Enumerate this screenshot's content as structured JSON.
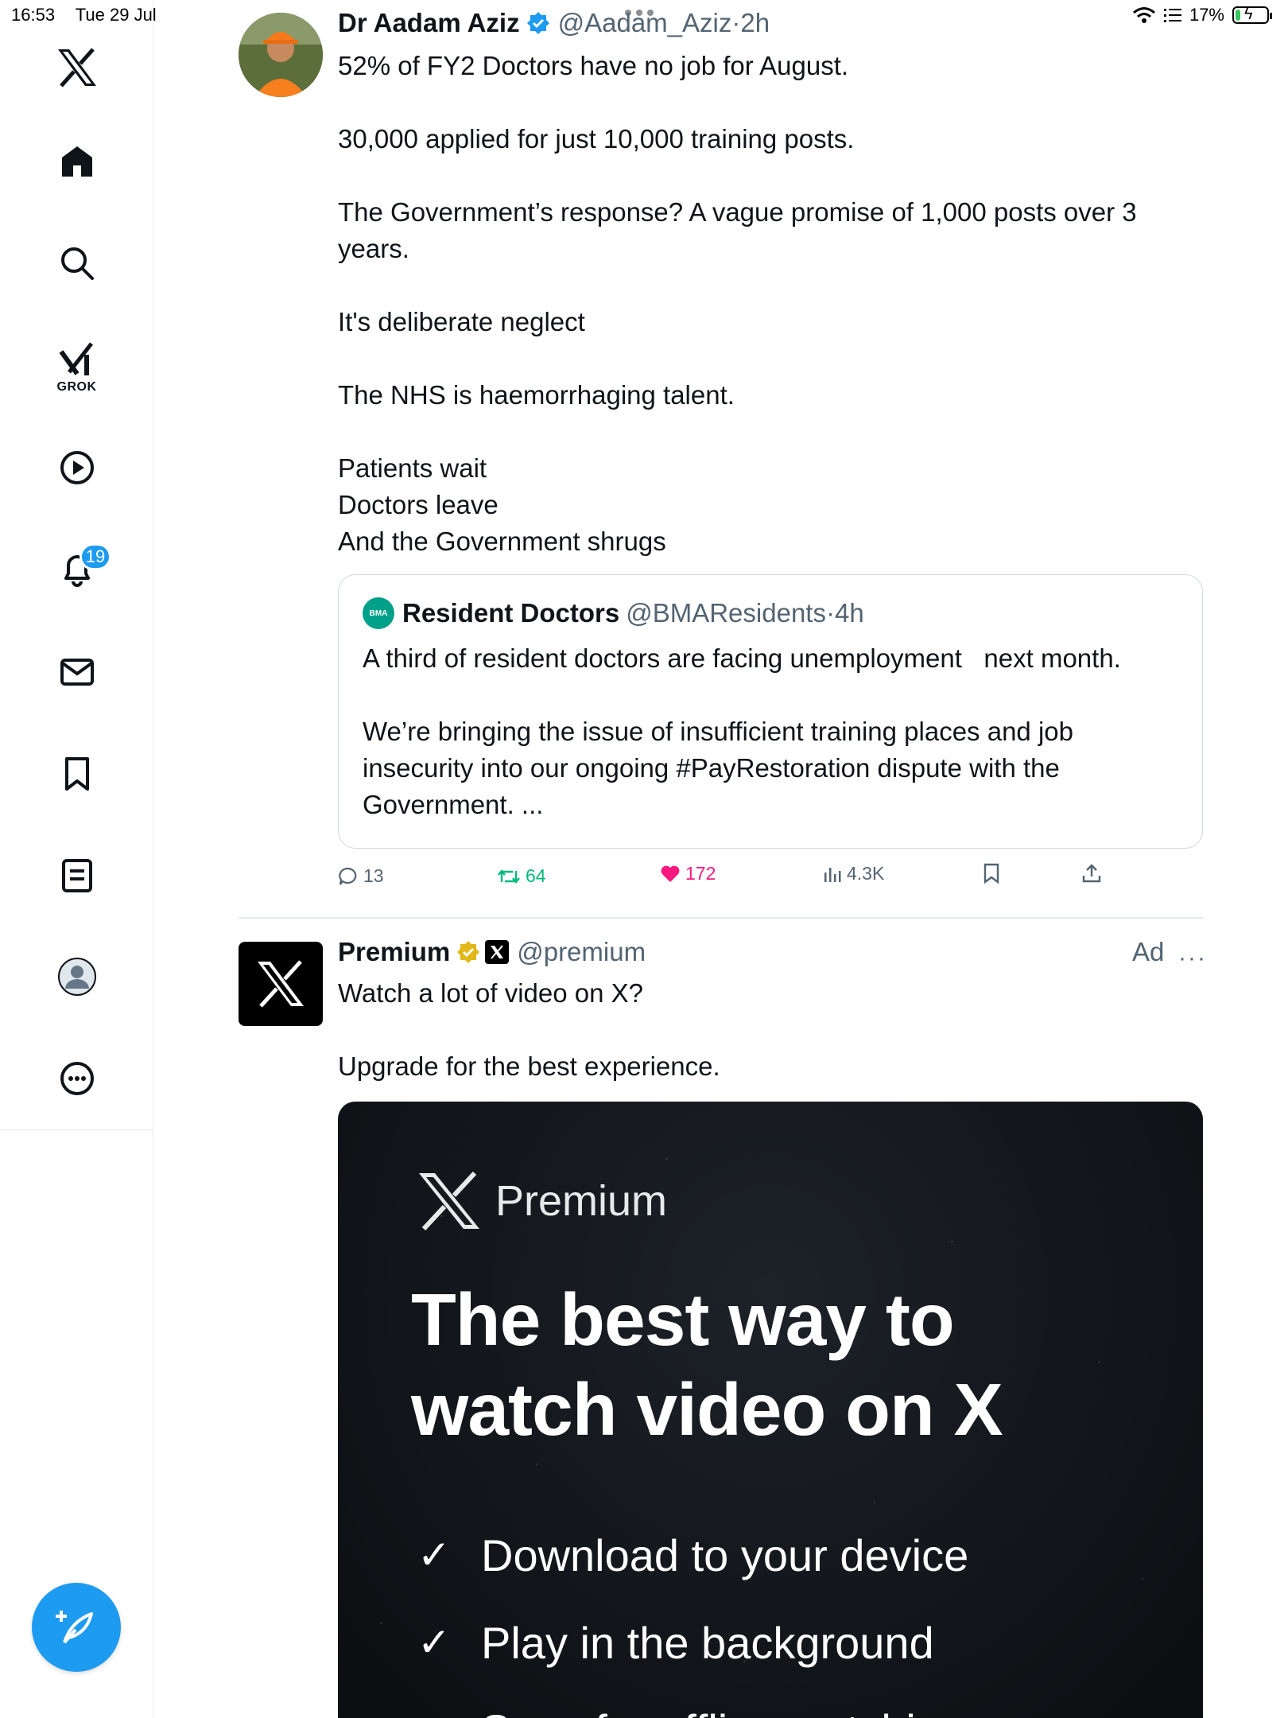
{
  "status_bar": {
    "time": "16:53",
    "date": "Tue 29 Jul",
    "battery": "17%",
    "battery_level": 0.17
  },
  "sidebar": {
    "items": [
      {
        "name": "x-logo",
        "icon": "x-logo-icon"
      },
      {
        "name": "home",
        "icon": "home-icon"
      },
      {
        "name": "explore",
        "icon": "search-icon"
      },
      {
        "name": "grok",
        "icon": "grok-icon",
        "label": "GROK"
      },
      {
        "name": "video",
        "icon": "play-icon"
      },
      {
        "name": "notifications",
        "icon": "bell-icon",
        "badge": "19"
      },
      {
        "name": "messages",
        "icon": "mail-icon"
      },
      {
        "name": "bookmarks",
        "icon": "bookmark-icon"
      },
      {
        "name": "lists",
        "icon": "list-icon"
      },
      {
        "name": "profile",
        "icon": "profile-icon"
      },
      {
        "name": "more",
        "icon": "more-icon"
      }
    ],
    "compose_icon": "compose-icon"
  },
  "tweet": {
    "author_name": "Dr Aadam Aziz",
    "handle": "@Aadam_Aziz",
    "time": "2h",
    "lines": [
      "52% of FY2 Doctors have no job for August.",
      "",
      "30,000 applied for just 10,000 training posts.",
      "",
      "The Government’s response? A vague promise of 1,000 posts over 3 years.",
      "",
      "It's deliberate neglect",
      "",
      "The NHS is haemorrhaging talent.",
      "",
      "Patients wait",
      "Doctors leave",
      "And the Government shrugs"
    ],
    "quote": {
      "logo_text": "BMA",
      "author_name": "Resident Doctors",
      "handle": "@BMAResidents",
      "time": "4h",
      "line1": "A third of resident doctors are facing unemployment   next month.",
      "line2": "We’re bringing the issue of insufficient training places and job insecurity into our ongoing #PayRestoration dispute with the Government. ..."
    },
    "actions": {
      "replies": "13",
      "reposts": "64",
      "likes": "172",
      "views": "4.3K"
    },
    "colors": {
      "repost": "#00ba7c",
      "like": "#f91880",
      "verified": "#1d9bf0"
    }
  },
  "ad": {
    "author_name": "Premium",
    "handle": "@premium",
    "label": "Ad",
    "more": "···",
    "line1": "Watch a lot of video on X?",
    "line2": "Upgrade for the best experience.",
    "promo": {
      "brand": "Premium",
      "headline": "The best way to watch video on X",
      "items": [
        "Download to your device",
        "Play in the background",
        "Save for offline watching"
      ],
      "check": "✓"
    },
    "colors": {
      "gold_verified": "#e2b719"
    }
  }
}
